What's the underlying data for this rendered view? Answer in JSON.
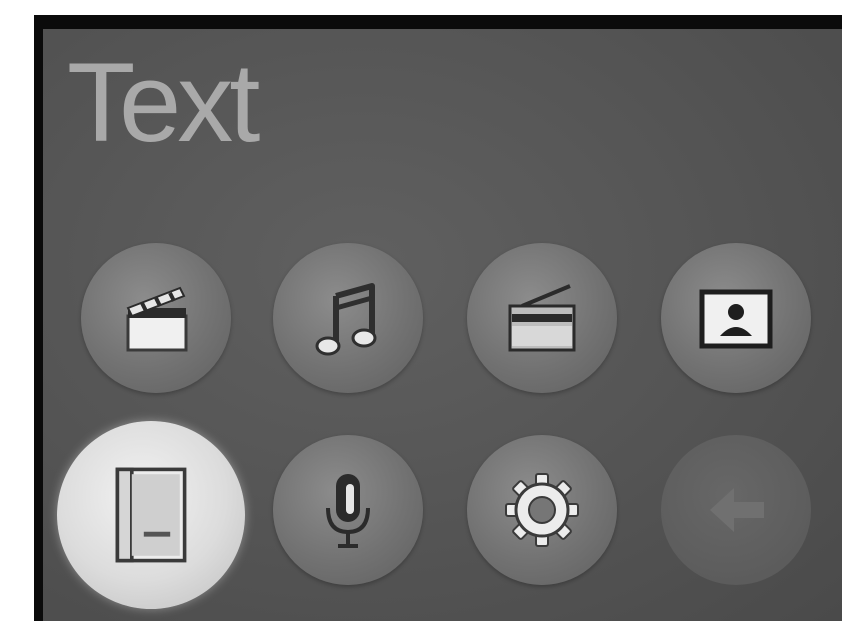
{
  "screen": {
    "title": "Text"
  },
  "menu": {
    "items": [
      {
        "name": "video",
        "icon": "clapperboard-icon",
        "selected": false
      },
      {
        "name": "music",
        "icon": "music-note-icon",
        "selected": false
      },
      {
        "name": "radio",
        "icon": "radio-icon",
        "selected": false
      },
      {
        "name": "photo",
        "icon": "photo-icon",
        "selected": false
      },
      {
        "name": "text",
        "icon": "book-icon",
        "selected": true
      },
      {
        "name": "voice-recorder",
        "icon": "microphone-icon",
        "selected": false
      },
      {
        "name": "settings",
        "icon": "gear-icon",
        "selected": false
      },
      {
        "name": "back",
        "icon": "back-arrow-icon",
        "selected": false
      }
    ]
  },
  "colors": {
    "bezel": "#0b0b0b",
    "screen_background": "#555555",
    "title_text": "#a9a9a9",
    "selected_item": "#e0e0e0"
  }
}
